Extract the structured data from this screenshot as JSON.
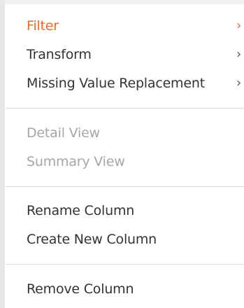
{
  "menu": {
    "items": [
      {
        "label": "Filter",
        "submenu": true,
        "state": "active"
      },
      {
        "label": "Transform",
        "submenu": true,
        "state": "normal"
      },
      {
        "label": "Missing Value Replacement",
        "submenu": true,
        "state": "normal"
      },
      {
        "label": "Detail View",
        "submenu": false,
        "state": "disabled"
      },
      {
        "label": "Summary View",
        "submenu": false,
        "state": "disabled"
      },
      {
        "label": "Rename Column",
        "submenu": false,
        "state": "normal"
      },
      {
        "label": "Create New Column",
        "submenu": false,
        "state": "normal"
      },
      {
        "label": "Remove Column",
        "submenu": false,
        "state": "normal"
      }
    ],
    "chevron_glyph": "›",
    "icons": {
      "submenu": "chevron-right-icon"
    }
  },
  "colors": {
    "accent": "#ee6a2b",
    "text": "#333333",
    "disabled_text": "#a6a6a6",
    "divider": "#dcdcdc"
  }
}
